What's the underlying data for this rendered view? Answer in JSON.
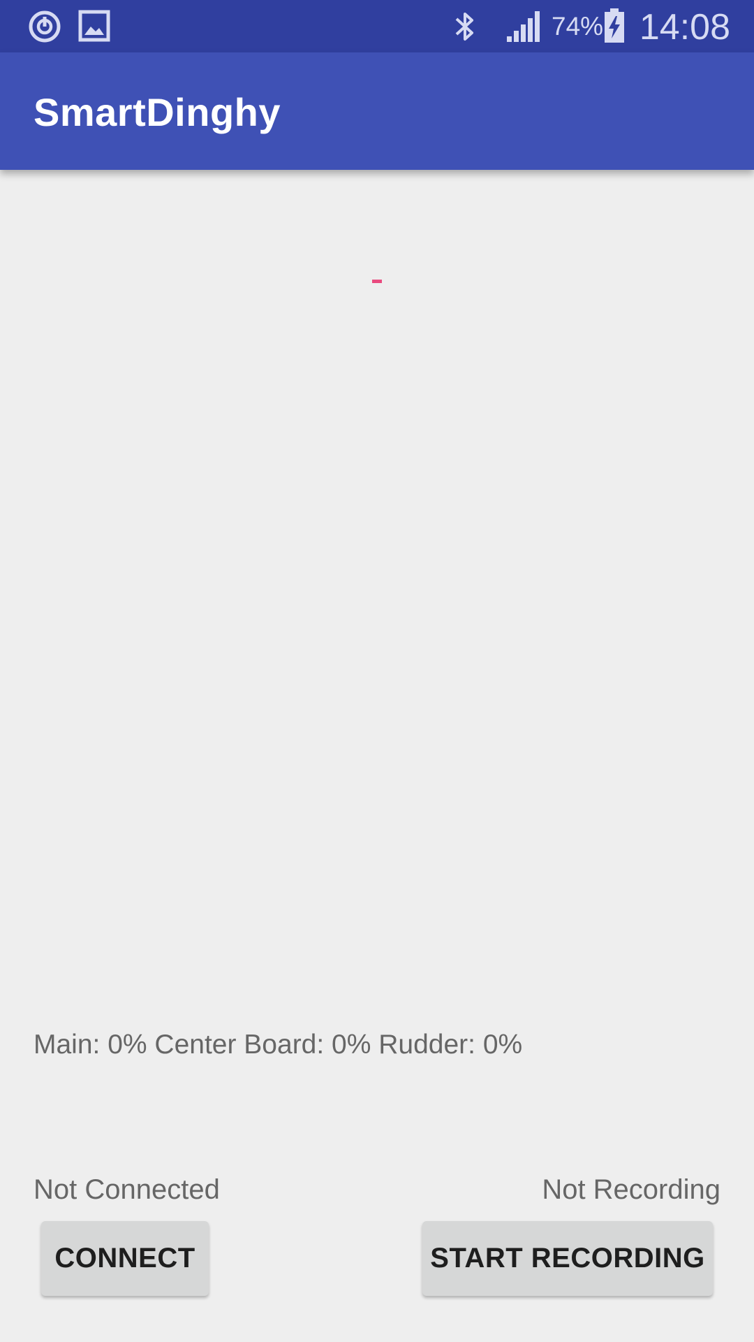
{
  "status_bar": {
    "icons_left": [
      "sync-icon",
      "image-icon"
    ],
    "icons_right": [
      "bluetooth-icon",
      "signal-icon",
      "battery-charging-icon"
    ],
    "battery_percent": "74%",
    "time": "14:08"
  },
  "app_bar": {
    "title": "SmartDinghy"
  },
  "main": {
    "sensor_readout": "Main: 0% Center Board: 0% Rudder: 0%",
    "connection_status": "Not Connected",
    "recording_status": "Not Recording",
    "connect_button": "CONNECT",
    "record_button": "START RECORDING"
  },
  "colors": {
    "status_bar": "#303f9f",
    "app_bar": "#3f51b5",
    "accent": "#e94a7f",
    "background": "#eeeeee"
  }
}
